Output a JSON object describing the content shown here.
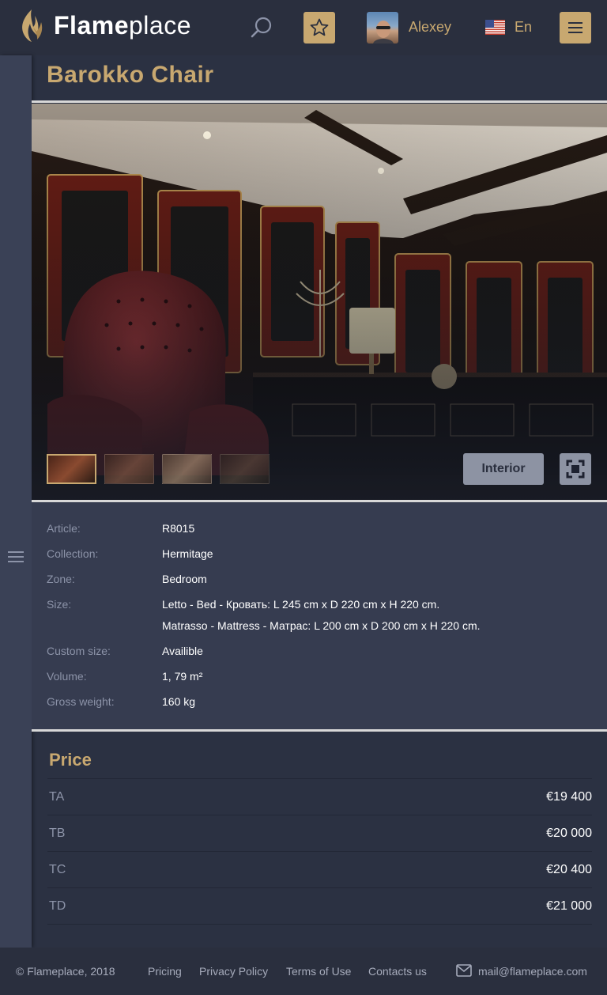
{
  "header": {
    "brand_bold": "Flame",
    "brand_light": "place",
    "user_name": "Alexey",
    "language": "En",
    "icons": {
      "logo": "flame-logo-icon",
      "search": "search-icon",
      "favorite": "star-icon",
      "flag": "us-flag-icon",
      "menu": "hamburger-menu-icon"
    }
  },
  "product": {
    "title": "Barokko Chair"
  },
  "gallery": {
    "interior_label": "Interior",
    "thumbnail_count": 4,
    "active_thumbnail": 1,
    "fullscreen_icon": "fullscreen-icon"
  },
  "specs": [
    {
      "label": "Article:",
      "values": [
        "R8015"
      ]
    },
    {
      "label": "Collection:",
      "values": [
        "Hermitage"
      ]
    },
    {
      "label": "Zone:",
      "values": [
        "Bedroom"
      ]
    },
    {
      "label": "Size:",
      "values": [
        "Letto - Bed - Кровать: L 245 cm x D 220 cm x H 220 cm.",
        "Matrasso - Mattress - Матрас: L 200 cm x D 200 cm x H 220 cm."
      ]
    },
    {
      "label": "Custom size:",
      "values": [
        "Availible"
      ]
    },
    {
      "label": "Volume:",
      "values": [
        "1, 79 m²"
      ]
    },
    {
      "label": "Gross weight:",
      "values": [
        "160 kg"
      ]
    }
  ],
  "price": {
    "title": "Price",
    "rows": [
      {
        "tier": "TA",
        "amount": "€19 400"
      },
      {
        "tier": "TB",
        "amount": "€20 000"
      },
      {
        "tier": "TC",
        "amount": "€20 400"
      },
      {
        "tier": "TD",
        "amount": "€21 000"
      }
    ]
  },
  "footer": {
    "copyright": "© Flameplace, 2018",
    "links": [
      "Pricing",
      "Privacy Policy",
      "Terms of Use",
      "Contacts us"
    ],
    "email": "mail@flameplace.com",
    "mail_icon": "mail-icon"
  },
  "colors": {
    "accent": "#c8a870",
    "header_bg": "#2a2f3e",
    "page_bg": "#2b3142",
    "panel_bg": "#363c50"
  }
}
